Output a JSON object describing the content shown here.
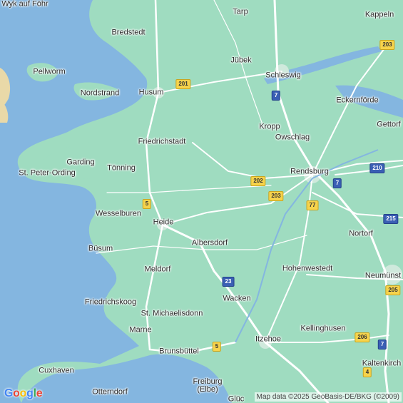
{
  "map": {
    "colors": {
      "land": "#9fdcc0",
      "water": "#84b6e0",
      "road": "#ffffff",
      "town": "#cfe9dc"
    },
    "places": [
      {
        "id": "wyk-auf-foehr",
        "label": "Wyk auf Föhr"
      },
      {
        "id": "bredstedt",
        "label": "Bredstedt"
      },
      {
        "id": "tarp",
        "label": "Tarp"
      },
      {
        "id": "kappeln",
        "label": "Kappeln"
      },
      {
        "id": "pellworm",
        "label": "Pellworm"
      },
      {
        "id": "juebek",
        "label": "Jübek"
      },
      {
        "id": "schleswig",
        "label": "Schleswig"
      },
      {
        "id": "nordstrand",
        "label": "Nordstrand"
      },
      {
        "id": "husum",
        "label": "Husum"
      },
      {
        "id": "eckernfoerde",
        "label": "Eckernförde"
      },
      {
        "id": "kropp",
        "label": "Kropp"
      },
      {
        "id": "gettorf",
        "label": "Gettorf"
      },
      {
        "id": "owschlag",
        "label": "Owschlag"
      },
      {
        "id": "friedrichstadt",
        "label": "Friedrichstadt"
      },
      {
        "id": "garding",
        "label": "Garding"
      },
      {
        "id": "toenning",
        "label": "Tönning"
      },
      {
        "id": "rendsburg",
        "label": "Rendsburg"
      },
      {
        "id": "st-peter-ording",
        "label": "St. Peter-Ording"
      },
      {
        "id": "wesselburen",
        "label": "Wesselburen"
      },
      {
        "id": "heide",
        "label": "Heide"
      },
      {
        "id": "nortorf",
        "label": "Nortorf"
      },
      {
        "id": "albersdorf",
        "label": "Albersdorf"
      },
      {
        "id": "buesum",
        "label": "Büsum"
      },
      {
        "id": "meldorf",
        "label": "Meldorf"
      },
      {
        "id": "hohenwestedt",
        "label": "Hohenwestedt"
      },
      {
        "id": "neumuenster",
        "label": "Neumünst"
      },
      {
        "id": "friedrichskoog",
        "label": "Friedrichskoog"
      },
      {
        "id": "wacken",
        "label": "Wacken"
      },
      {
        "id": "st-michaelisdonn",
        "label": "St. Michaelisdonn"
      },
      {
        "id": "marne",
        "label": "Marne"
      },
      {
        "id": "itzehoe",
        "label": "Itzehoe"
      },
      {
        "id": "kellinghusen",
        "label": "Kellinghusen"
      },
      {
        "id": "brunsbuettel",
        "label": "Brunsbüttel"
      },
      {
        "id": "cuxhaven",
        "label": "Cuxhaven"
      },
      {
        "id": "kaltenkirchen",
        "label": "Kaltenkirch"
      },
      {
        "id": "otterndorf",
        "label": "Otterndorf"
      },
      {
        "id": "freiburg-elbe",
        "label": "Freiburg\n(Elbe)"
      },
      {
        "id": "glueckstadt",
        "label": "Glüc"
      }
    ],
    "road_shields": [
      {
        "id": "b201",
        "label": "201",
        "kind": "fed"
      },
      {
        "id": "b203-ne",
        "label": "203",
        "kind": "fed"
      },
      {
        "id": "a7-north",
        "label": "7",
        "kind": "auto"
      },
      {
        "id": "b202",
        "label": "202",
        "kind": "fed"
      },
      {
        "id": "b210",
        "label": "210",
        "kind": "fed"
      },
      {
        "id": "b203",
        "label": "203",
        "kind": "fed"
      },
      {
        "id": "a7-mid",
        "label": "7",
        "kind": "auto"
      },
      {
        "id": "b5-north",
        "label": "5",
        "kind": "fed"
      },
      {
        "id": "b77",
        "label": "77",
        "kind": "fed"
      },
      {
        "id": "b215",
        "label": "215",
        "kind": "fed"
      },
      {
        "id": "a23",
        "label": "23",
        "kind": "auto"
      },
      {
        "id": "b205",
        "label": "205",
        "kind": "fed"
      },
      {
        "id": "b206",
        "label": "206",
        "kind": "fed"
      },
      {
        "id": "a7-south",
        "label": "7",
        "kind": "auto"
      },
      {
        "id": "b5-south",
        "label": "5",
        "kind": "fed"
      },
      {
        "id": "b4",
        "label": "4",
        "kind": "fed"
      }
    ],
    "logo": "Google",
    "attribution": "Map data ©2025 GeoBasis-DE/BKG (©2009)"
  }
}
